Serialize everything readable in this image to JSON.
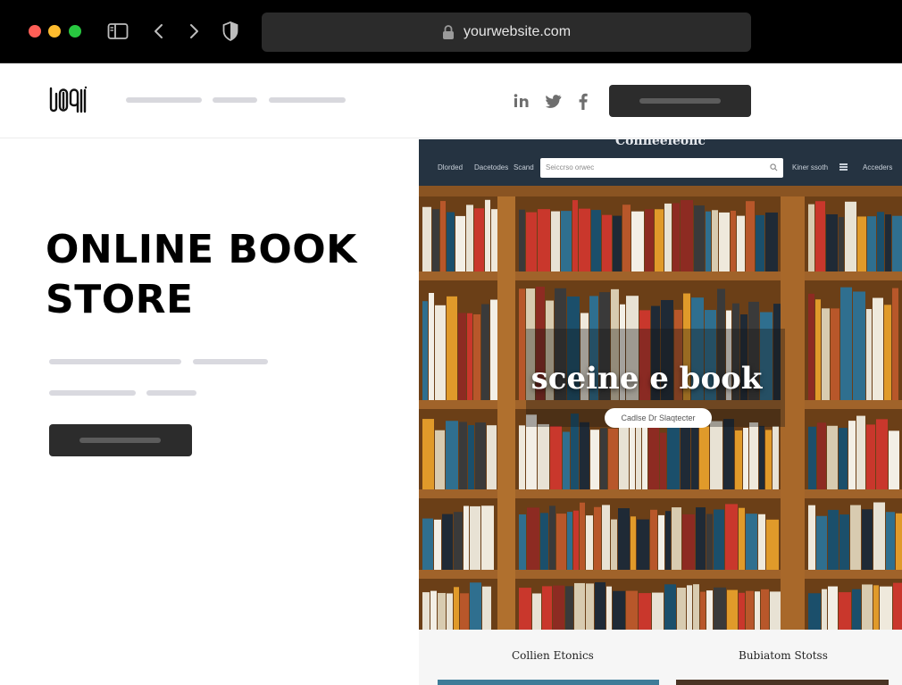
{
  "browser": {
    "url": "yourwebsite.com",
    "traffic_lights": [
      "#ff5f57",
      "#febc2e",
      "#28c840"
    ],
    "icons": [
      "sidebar-icon",
      "back-chevron-icon",
      "forward-chevron-icon",
      "shield-icon",
      "lock-icon"
    ]
  },
  "site": {
    "logo_name": "logo-icon",
    "social": [
      "linkedin-icon",
      "twitter-icon",
      "facebook-icon"
    ],
    "hero_title_line1": "ONLINE BOOK",
    "hero_title_line2": "STORE"
  },
  "mockup": {
    "brand": "Conneeleonc",
    "nav_left": [
      "Dlorded",
      "Dacetodes",
      "Scand"
    ],
    "search_placeholder": "Seiccrso orwec",
    "nav_right": [
      "Kiner ssoth",
      "Acceders"
    ],
    "heading": "sceine e book",
    "pill": "Cadlse Dr Slaqtecter",
    "captions": [
      "Collien Etonics",
      "Bubiatom Stotss"
    ]
  },
  "colors": {
    "accent_dark": "#2c2c2c",
    "placeholder_line": "#d8d8dd",
    "mock_nav_bg": "#253341",
    "shelf_wood": "#7a4a1e"
  }
}
